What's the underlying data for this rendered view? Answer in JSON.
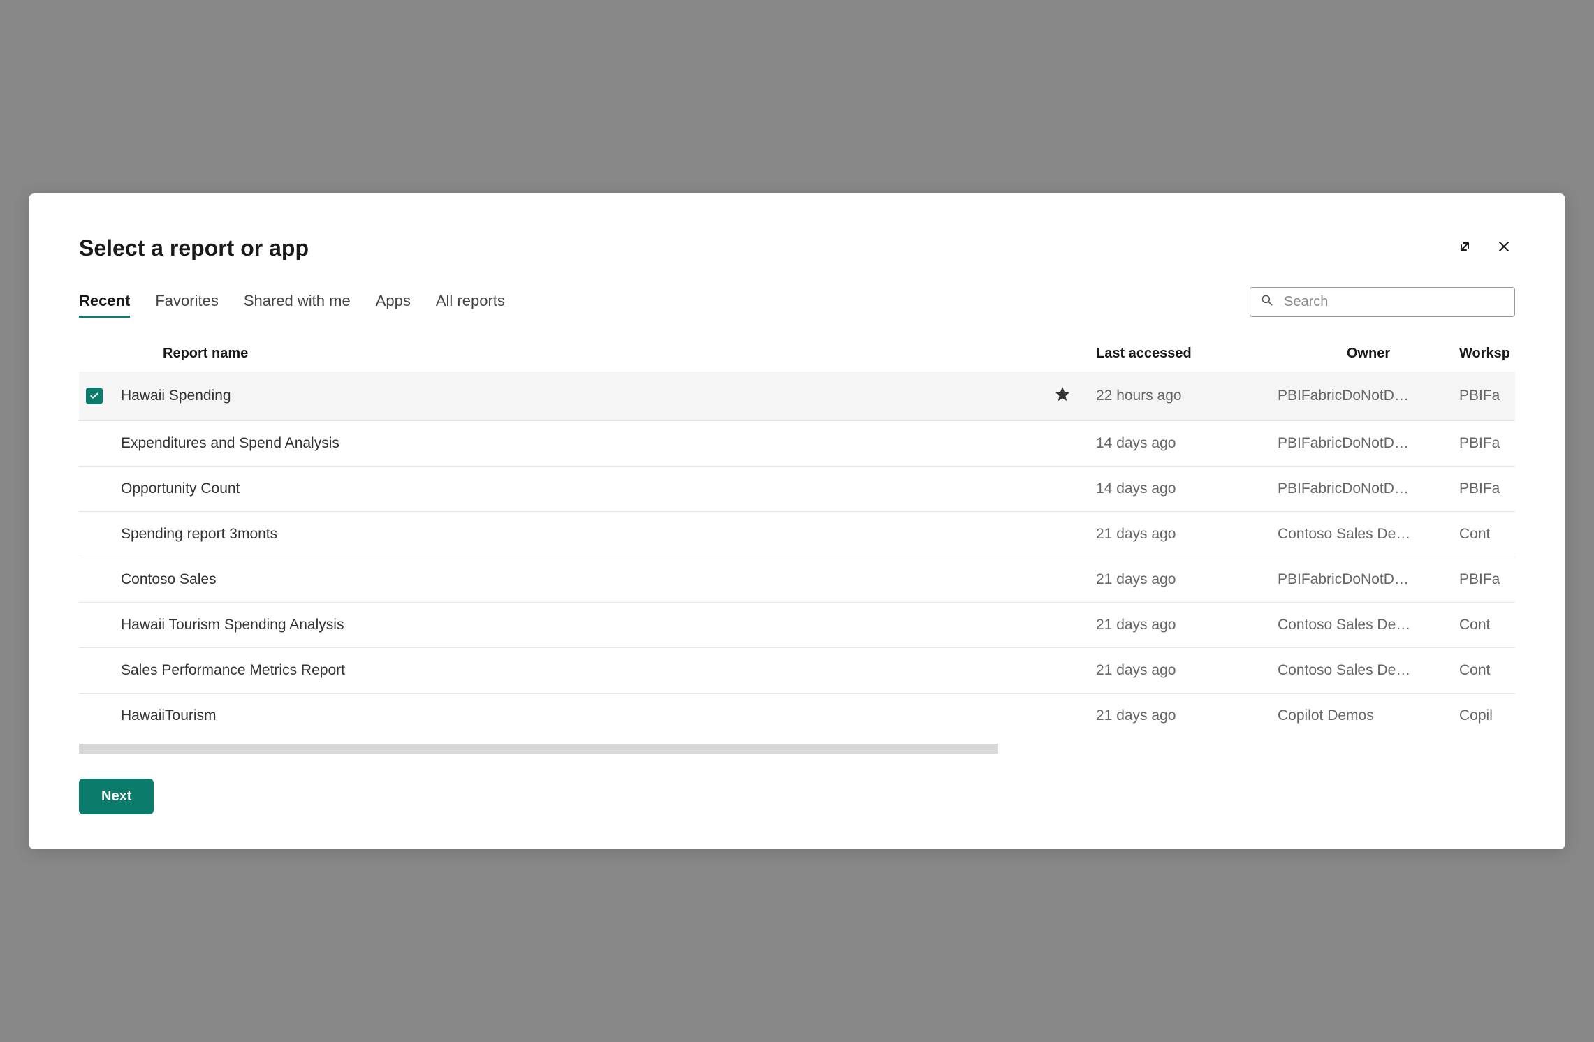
{
  "modal": {
    "title": "Select a report or app"
  },
  "tabs": {
    "items": [
      {
        "label": "Recent",
        "active": true
      },
      {
        "label": "Favorites",
        "active": false
      },
      {
        "label": "Shared with me",
        "active": false
      },
      {
        "label": "Apps",
        "active": false
      },
      {
        "label": "All reports",
        "active": false
      }
    ]
  },
  "search": {
    "placeholder": "Search"
  },
  "table": {
    "headers": {
      "name": "Report name",
      "accessed": "Last accessed",
      "owner": "Owner",
      "workspace": "Worksp"
    },
    "rows": [
      {
        "name": "Hawaii Spending",
        "accessed": "22 hours ago",
        "owner": "PBIFabricDoNotD…",
        "workspace": "PBIFa",
        "selected": true,
        "favorite": true
      },
      {
        "name": "Expenditures and Spend Analysis",
        "accessed": "14 days ago",
        "owner": "PBIFabricDoNotD…",
        "workspace": "PBIFa",
        "selected": false,
        "favorite": false
      },
      {
        "name": "Opportunity Count",
        "accessed": "14 days ago",
        "owner": "PBIFabricDoNotD…",
        "workspace": "PBIFa",
        "selected": false,
        "favorite": false
      },
      {
        "name": "Spending report 3monts",
        "accessed": "21 days ago",
        "owner": "Contoso Sales De…",
        "workspace": "Cont",
        "selected": false,
        "favorite": false
      },
      {
        "name": "Contoso Sales",
        "accessed": "21 days ago",
        "owner": "PBIFabricDoNotD…",
        "workspace": "PBIFa",
        "selected": false,
        "favorite": false
      },
      {
        "name": "Hawaii Tourism Spending Analysis",
        "accessed": "21 days ago",
        "owner": "Contoso Sales De…",
        "workspace": "Cont",
        "selected": false,
        "favorite": false
      },
      {
        "name": "Sales Performance Metrics Report",
        "accessed": "21 days ago",
        "owner": "Contoso Sales De…",
        "workspace": "Cont",
        "selected": false,
        "favorite": false
      },
      {
        "name": "HawaiiTourism",
        "accessed": "21 days ago",
        "owner": "Copilot Demos",
        "workspace": "Copil",
        "selected": false,
        "favorite": false
      }
    ]
  },
  "footer": {
    "next": "Next"
  }
}
